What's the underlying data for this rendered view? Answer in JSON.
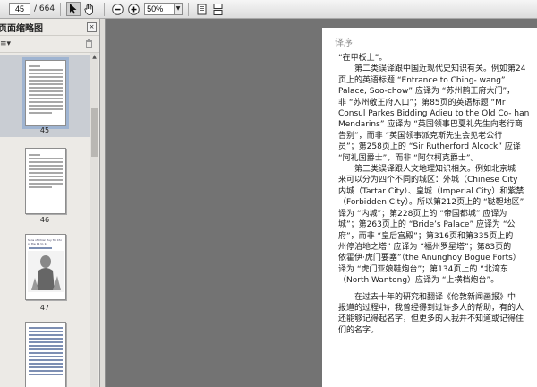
{
  "toolbar": {
    "page_current": "45",
    "page_total": "/ 664",
    "zoom": "50%",
    "icons": [
      "select-arrow-icon",
      "hand-icon",
      "zoom-out-icon",
      "zoom-in-icon",
      "single-page-icon",
      "continuous-page-icon"
    ]
  },
  "panel": {
    "title": "页面缩略图",
    "options_label": "≡▾",
    "close_label": "×",
    "thumbnails": [
      {
        "label": "45"
      },
      {
        "label": "46"
      },
      {
        "label": "47",
        "lines": [
          "Sons of Chiar Huy Tai Chi of the 11 to 12",
          "(Pho"
        ]
      },
      {
        "label": ""
      }
    ]
  },
  "document": {
    "header": "译序",
    "lines": [
      "“在甲板上”。",
      "　　第二类误译跟中国近现代史知识有关。例如第24",
      "页上的英语标题 “Entrance to Ching- wang”",
      "Palace, Soo-chow” 应译为 “苏州鹤王府大门”，",
      "非 “苏州敬王府入口”；第85页的英语标题 “Mr",
      "Consul Parkes Bidding Adieu to the Old Co- han",
      "Mendarins” 应译为 “英国领事巴夏礼先生向老行商",
      "告别”，而非 “英国领事派克斯先生会见老公行",
      "员”；第258页上的 “Sir Rutherford Alcock” 应译",
      "“阿礼国爵士”，而非 “阿尔柯克爵士”。",
      "　　第三类误译跟人文地理知识相关。例如北京城",
      "来可以分为四个不同的城区：外城（Chinese City",
      "内城（Tartar City）、皇城（Imperial City）和紫禁",
      "（Forbidden City）。所以第212页上的 “鞑靼地区”",
      "译为 “内城”；第228页上的 “帝国都城” 应译为",
      "城”；第263页上的 “Bride’s Palace” 应译为 “公",
      "府”，而非 “皇后宫殿”；第316页和第335页上的",
      "州停泊地之塔” 应译为 “福州罗星塔”；第83页的",
      "依霍伊·虎门要塞”（the Anunghoy Bogue Forts）",
      "译为 “虎门亚娘鞋炮台”；第134页上的 “北湾东",
      "（North Wantong）应译为 “上横档炮台”。",
      "",
      "　　在过去十年的研究和翻译《伦敦新闻画报》中",
      "报道的过程中，我曾经得到过许多人的帮助，有的人",
      "还能够记得起名字，但更多的人我并不知道或记得住",
      "们的名字。"
    ]
  }
}
